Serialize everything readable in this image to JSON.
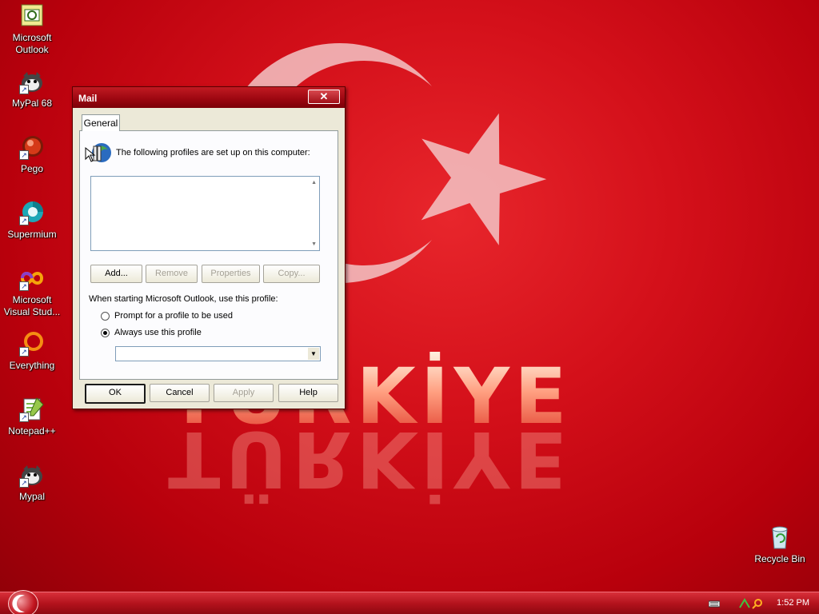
{
  "wallpaper": {
    "text": "TÜRKİYE",
    "reflection": "TÜRKİYE",
    "colors": {
      "bg": "#c80c16",
      "crescent": "#f3c4c6"
    }
  },
  "desktop_icons": [
    {
      "name": "outlook",
      "label": "Microsoft Outlook",
      "icon": "outlook-icon",
      "shortcut": false
    },
    {
      "name": "mypal68",
      "label": "MyPal 68",
      "icon": "mypal-icon",
      "shortcut": true
    },
    {
      "name": "pego",
      "label": "Pego",
      "icon": "pego-icon",
      "shortcut": true
    },
    {
      "name": "supermium",
      "label": "Supermium",
      "icon": "supermium-icon",
      "shortcut": true
    },
    {
      "name": "visual-studio",
      "label": "Microsoft Visual Stud...",
      "icon": "visual-studio-icon",
      "shortcut": true
    },
    {
      "name": "everything",
      "label": "Everything",
      "icon": "everything-icon",
      "shortcut": true
    },
    {
      "name": "notepadpp",
      "label": "Notepad++",
      "icon": "notepadpp-icon",
      "shortcut": true
    },
    {
      "name": "mypal",
      "label": "Mypal",
      "icon": "mypal-icon",
      "shortcut": true
    },
    {
      "name": "recycle-bin",
      "label": "Recycle Bin",
      "icon": "recycle-bin-icon",
      "shortcut": false
    }
  ],
  "dialog": {
    "title": "Mail",
    "close_label": "✕",
    "tab_general": "General",
    "intro_text": "The following profiles are set up on this computer:",
    "buttons": {
      "add": "Add...",
      "remove": "Remove",
      "properties": "Properties",
      "copy": "Copy..."
    },
    "startup_label": "When starting Microsoft Outlook, use this profile:",
    "radio_prompt": "Prompt for a profile to be used",
    "radio_always": "Always use this profile",
    "selected_radio": "always",
    "profile_combo_value": "",
    "footer": {
      "ok": "OK",
      "cancel": "Cancel",
      "apply": "Apply",
      "help": "Help"
    }
  },
  "taskbar": {
    "clock": "1:52 PM"
  }
}
